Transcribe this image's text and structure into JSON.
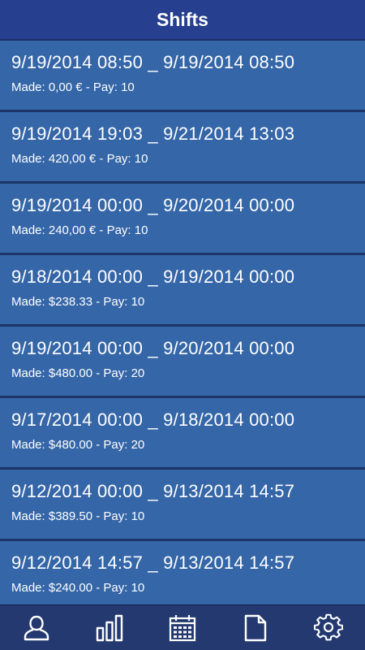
{
  "header": {
    "title": "Shifts"
  },
  "shifts": [
    {
      "range": "9/19/2014 08:50 _ 9/19/2014 08:50",
      "meta": "Made: 0,00 € - Pay: 10"
    },
    {
      "range": "9/19/2014 19:03 _ 9/21/2014 13:03",
      "meta": "Made: 420,00 € - Pay: 10"
    },
    {
      "range": "9/19/2014 00:00 _ 9/20/2014 00:00",
      "meta": "Made: 240,00 € - Pay: 10"
    },
    {
      "range": "9/18/2014 00:00 _ 9/19/2014 00:00",
      "meta": "Made: $238.33 - Pay: 10"
    },
    {
      "range": "9/19/2014 00:00 _ 9/20/2014 00:00",
      "meta": "Made: $480.00 - Pay: 20"
    },
    {
      "range": "9/17/2014 00:00 _ 9/18/2014 00:00",
      "meta": "Made: $480.00 - Pay: 20"
    },
    {
      "range": "9/12/2014 00:00 _ 9/13/2014 14:57",
      "meta": "Made: $389.50 - Pay: 10"
    },
    {
      "range": "9/12/2014 14:57 _ 9/13/2014 14:57",
      "meta": "Made: $240.00 - Pay: 10"
    }
  ],
  "bottom_nav": [
    {
      "icon": "user-icon"
    },
    {
      "icon": "bar-chart-icon"
    },
    {
      "icon": "calendar-icon"
    },
    {
      "icon": "document-icon"
    },
    {
      "icon": "gear-icon"
    }
  ],
  "colors": {
    "header_bg": "#263f8e",
    "item_bg": "#3566a8",
    "divider": "#1c3466",
    "nav_bg": "#23396f",
    "text": "#ffffff"
  }
}
